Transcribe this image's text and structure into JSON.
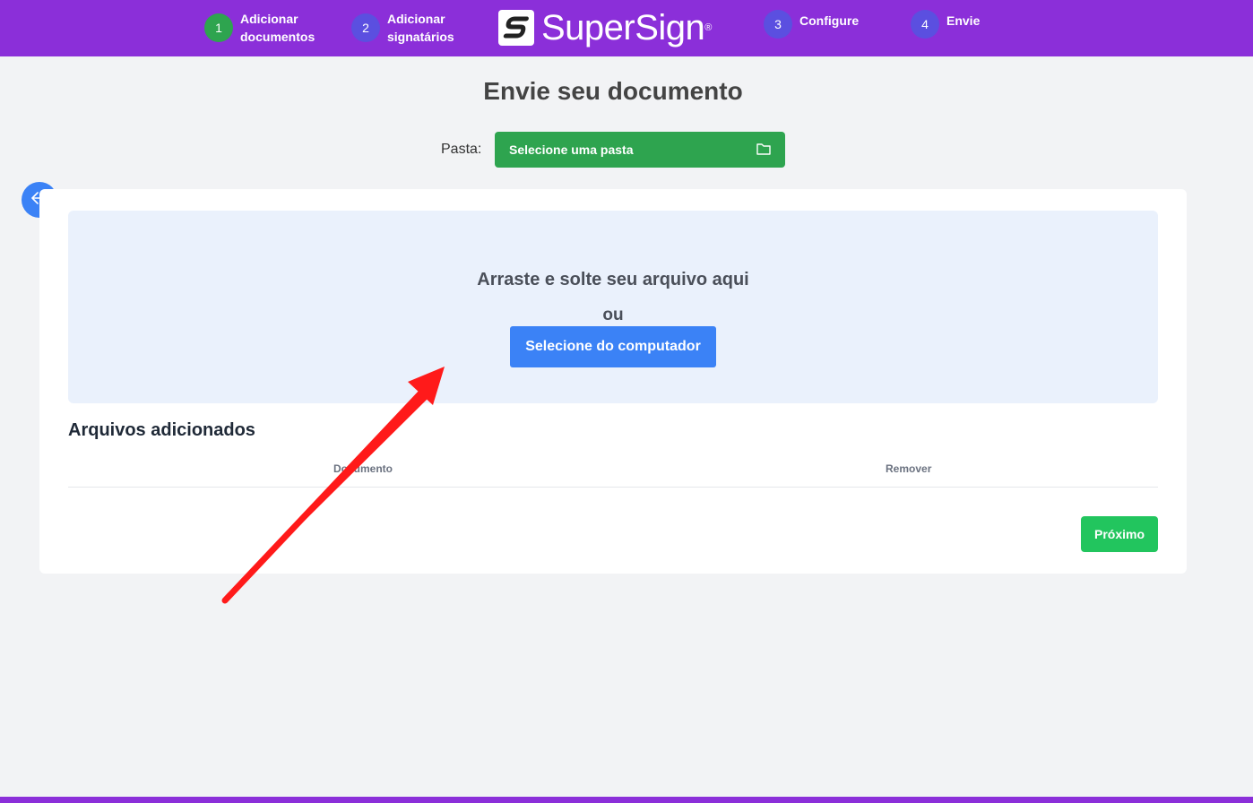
{
  "header": {
    "steps": [
      {
        "number": "1",
        "label_line1": "Adicionar",
        "label_line2": "documentos",
        "color": "#2ea44f"
      },
      {
        "number": "2",
        "label_line1": "Adicionar",
        "label_line2": "signatários",
        "color": "#5b4fe0"
      },
      {
        "number": "3",
        "label_line1": "Configure",
        "label_line2": "",
        "color": "#5b4fe0"
      },
      {
        "number": "4",
        "label_line1": "Envie",
        "label_line2": "",
        "color": "#5b4fe0"
      }
    ],
    "logo_text": "SuperSign",
    "logo_reg": "®",
    "background": "#8b2fd9"
  },
  "main": {
    "title": "Envie seu documento",
    "folder_label": "Pasta:",
    "folder_placeholder": "Selecione uma pasta"
  },
  "dropzone": {
    "text": "Arraste e solte seu arquivo aqui",
    "or": "ou",
    "button_label": "Selecione do computador"
  },
  "files": {
    "title": "Arquivos adicionados",
    "columns": [
      "Documento",
      "Remover"
    ]
  },
  "actions": {
    "next_label": "Próximo"
  },
  "icons": {
    "back": "arrow-left-icon",
    "folder": "folder-icon"
  },
  "colors": {
    "accent_purple": "#8b2fd9",
    "primary_blue": "#3b82f6",
    "success_green": "#22c55e",
    "annotation_red": "#ff1a1a"
  }
}
